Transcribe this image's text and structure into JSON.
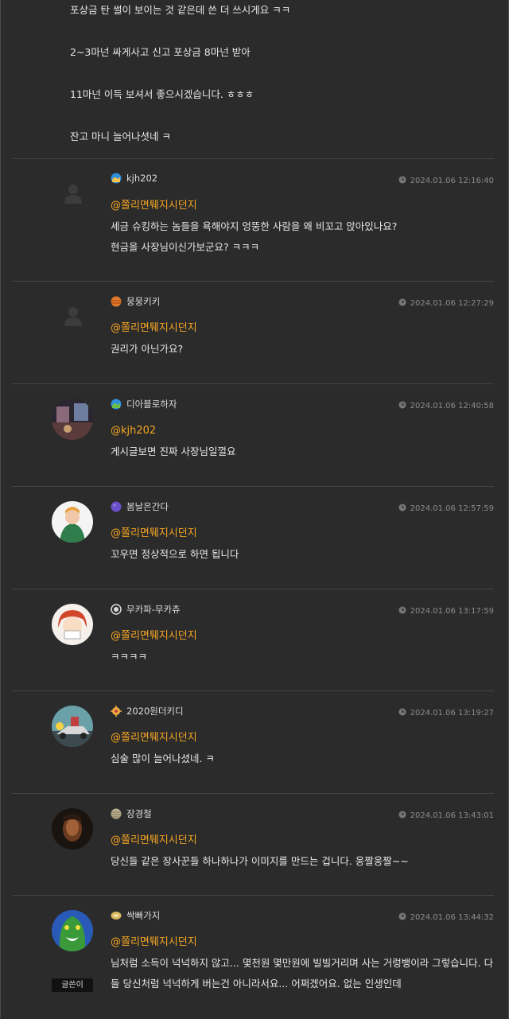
{
  "top_comment": {
    "lines": [
      "포상금 탄 썰이 보이는 것 같은데 쓴 더 쓰시게요 ㅋㅋ",
      "2~3마넌 싸게사고 신고 포상금 8마넌 받아",
      "11마넌 이득 보셔서 좋으시겠습니다. ㅎㅎㅎ",
      "잔고 마니 늘어나셧네 ㅋ"
    ]
  },
  "comments": [
    {
      "user": "kjh202",
      "time": "2024.01.06 12:16:40",
      "mention": "@쫄리면퉤지시던지",
      "lines": [
        "세금 슈킹하는 놈들을 욕해야지 엉뚱한 사람을 왜 비꼬고 앉아있나요?",
        "현금을 사장님이신가보군요? ㅋㅋㅋ"
      ],
      "avatar": "placeholder-icon"
    },
    {
      "user": "뭉뭉키키",
      "time": "2024.01.06 12:27:29",
      "mention": "@쫄리면퉤지시던지",
      "lines": [
        "권리가 아닌가요?"
      ],
      "avatar": "placeholder-icon"
    },
    {
      "user": "디아블로하자",
      "time": "2024.01.06 12:40:58",
      "mention": "@kjh202",
      "lines": [
        "게시글보면 진짜 사장님일껄요"
      ],
      "avatar": "game-scene-avatar"
    },
    {
      "user": "봄날은간다",
      "time": "2024.01.06 12:57:59",
      "mention": "@쫄리면퉤지시던지",
      "lines": [
        "꼬우면 정상적으로 하면 됩니다"
      ],
      "avatar": "anime-character-avatar"
    },
    {
      "user": "무카파-무카츄",
      "time": "2024.01.06 13:17:59",
      "mention": "@쫄리면퉤지시던지",
      "lines": [
        "ㅋㅋㅋㅋ"
      ],
      "avatar": "anime-girl-avatar"
    },
    {
      "user": "2020원더키디",
      "time": "2024.01.06 13:19:27",
      "mention": "@쫄리면퉤지시던지",
      "lines": [
        "심술 많이 늘어나셨네. ㅋ"
      ],
      "avatar": "robot-car-avatar"
    },
    {
      "user": "장경철",
      "time": "2024.01.06 13:43:01",
      "mention": "@쫄리면퉤지시던지",
      "lines": [
        "당신들 같은 장사꾼들 하나하나가 이미지를 만드는 겁니다. 웅짤웅짤~~"
      ],
      "avatar": "dark-portrait-avatar"
    },
    {
      "user": "싹빠가지",
      "time": "2024.01.06 13:44:32",
      "mention": "@쫄리면퉤지시던지",
      "lines": [
        "님처럼 소득이 넉넉하지 않고... 몇천원 몇만원에 빌빌거리며 사는 거렁뱅이라 그렇습니다. 다",
        "들 당신처럼 넉넉하게 버는건 아니라서요... 어쩌겠어요. 없는 인생인데"
      ],
      "avatar": "green-monster-avatar",
      "badge": "글쓴이"
    }
  ],
  "colors": {
    "background": "#2b2b2b",
    "mention": "#f5a623",
    "divider": "#444444",
    "meta": "#8c8c8c"
  }
}
